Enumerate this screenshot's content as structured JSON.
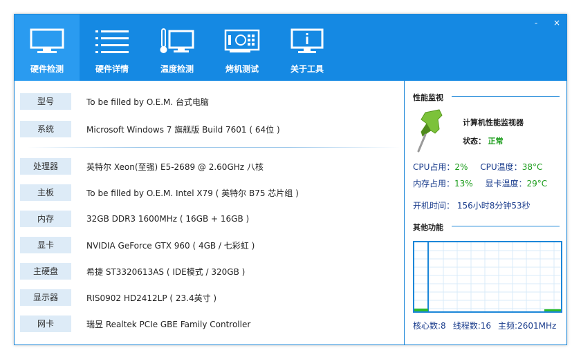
{
  "window_controls": {
    "minimize": "-",
    "close": "×"
  },
  "tabs": [
    {
      "label": "硬件检测",
      "icon": "monitor-icon",
      "active": true
    },
    {
      "label": "硬件详情",
      "icon": "list-icon",
      "active": false
    },
    {
      "label": "温度检测",
      "icon": "thermometer-monitor-icon",
      "active": false
    },
    {
      "label": "烤机测试",
      "icon": "graphics-card-icon",
      "active": false
    },
    {
      "label": "关于工具",
      "icon": "info-monitor-icon",
      "active": false
    }
  ],
  "hardware": {
    "model": {
      "label": "型号",
      "value": "To be filled by O.E.M. 台式电脑"
    },
    "os": {
      "label": "系统",
      "value": "Microsoft Windows 7 旗舰版 Build 7601 ( 64位 )"
    },
    "cpu": {
      "label": "处理器",
      "value": "英特尔 Xeon(至强) E5-2689 @ 2.60GHz 八核"
    },
    "motherboard": {
      "label": "主板",
      "value": "To be filled by O.E.M. Intel X79 ( 英特尔 B75 芯片组 )"
    },
    "memory": {
      "label": "内存",
      "value": "32GB DDR3 1600MHz ( 16GB + 16GB )"
    },
    "gpu": {
      "label": "显卡",
      "value": "NVIDIA GeForce GTX 960 ( 4GB / 七彩虹 )"
    },
    "disk": {
      "label": "主硬盘",
      "value": "希捷 ST3320613AS ( IDE模式 / 320GB )"
    },
    "display": {
      "label": "显示器",
      "value": "RIS0902 HD2412LP ( 23.4英寸 )"
    },
    "nic": {
      "label": "网卡",
      "value": "瑞昱 Realtek PCIe GBE Family Controller"
    }
  },
  "monitor": {
    "section_title": "性能监视",
    "name": "计算机性能监视器",
    "status_label": "状态：",
    "status_value": "正常",
    "cpu_usage_label": "CPU占用：",
    "cpu_usage_value": "2%",
    "cpu_temp_label": "CPU温度：",
    "cpu_temp_value": "38°C",
    "mem_usage_label": "内存占用：",
    "mem_usage_value": "13%",
    "gpu_temp_label": "显卡温度：",
    "gpu_temp_value": "29°C",
    "uptime": "开机时间： 156小时8分钟53秒"
  },
  "other": {
    "section_title": "其他功能",
    "cores": "核心数:8",
    "threads": "线程数:16",
    "freq": "主频:2601MHz"
  },
  "colors": {
    "header": "#1589e3",
    "active_tab": "#2a9bf0",
    "label_bg": "#ddebf7",
    "accent": "#1b86d8",
    "good": "#1a9c1a",
    "pin_green": "#7cc23a"
  }
}
